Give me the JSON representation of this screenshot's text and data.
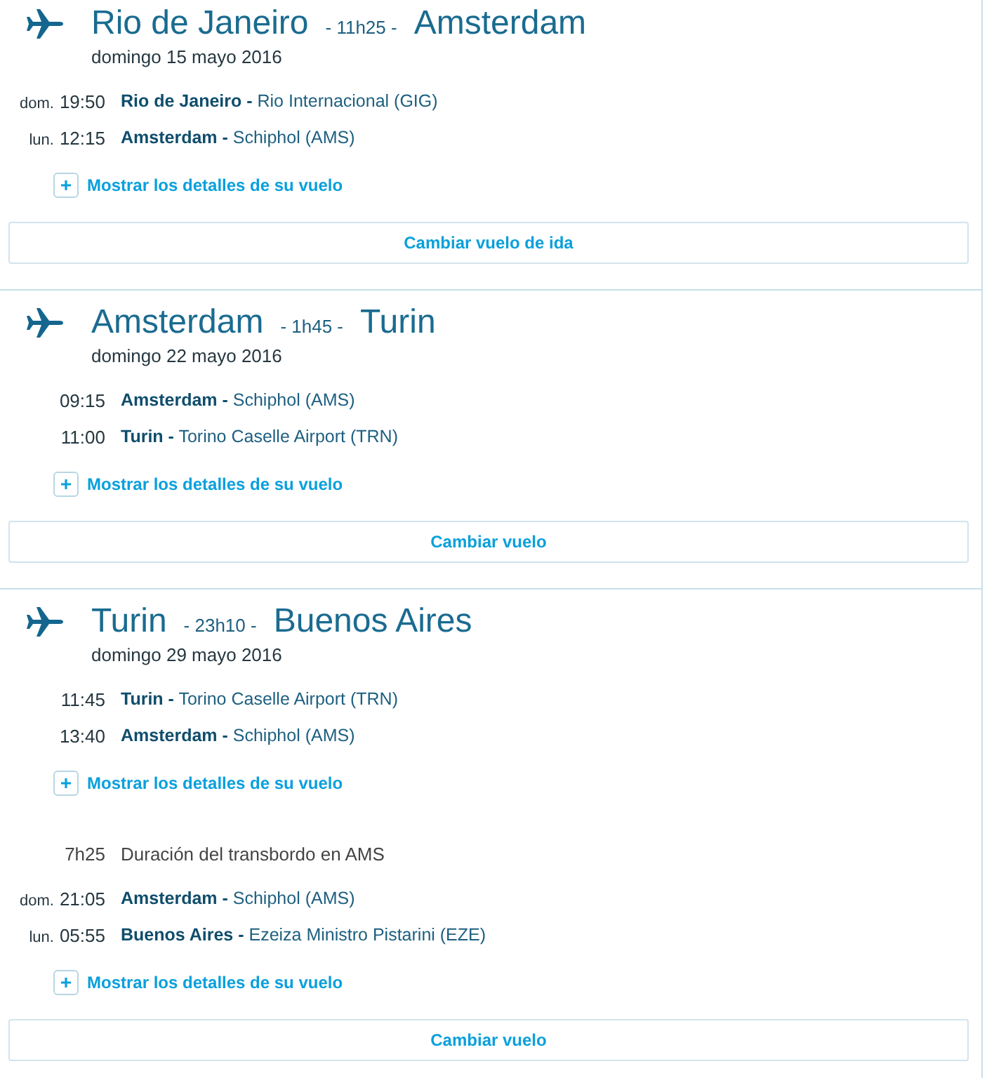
{
  "journeys": [
    {
      "origin": "Rio de Janeiro",
      "duration": "- 11h25 -",
      "destination": "Amsterdam",
      "date": "domingo 15 mayo 2016",
      "segments": [
        {
          "kind": "flight",
          "stops": [
            {
              "day": "dom.",
              "time": "19:50",
              "place": "**Rio de Janeiro -** Rio Internacional (GIG)"
            },
            {
              "day": "lun.",
              "time": "12:15",
              "place": "**Amsterdam -** Schiphol (AMS)"
            }
          ],
          "details_link": "Mostrar los detalles de su vuelo"
        }
      ],
      "change_button": "Cambiar vuelo de ida"
    },
    {
      "origin": "Amsterdam",
      "duration": "- 1h45 -",
      "destination": "Turin",
      "date": "domingo 22 mayo 2016",
      "segments": [
        {
          "kind": "flight",
          "stops": [
            {
              "time": "09:15",
              "place": "**Amsterdam -** Schiphol (AMS)"
            },
            {
              "time": "11:00",
              "place": "**Turin -** Torino Caselle Airport (TRN)"
            }
          ],
          "details_link": "Mostrar los detalles de su vuelo"
        }
      ],
      "change_button": "Cambiar vuelo"
    },
    {
      "origin": "Turin",
      "duration": "- 23h10 -",
      "destination": "Buenos Aires",
      "date": "domingo 29 mayo 2016",
      "segments": [
        {
          "kind": "flight",
          "stops": [
            {
              "time": "11:45",
              "place": "**Turin -** Torino Caselle Airport (TRN)"
            },
            {
              "time": "13:40",
              "place": "**Amsterdam -** Schiphol (AMS)"
            }
          ],
          "details_link": "Mostrar los detalles de su vuelo"
        },
        {
          "kind": "transfer",
          "duration": "7h25",
          "label": "Duración del transbordo en AMS"
        },
        {
          "kind": "flight",
          "stops": [
            {
              "day": "dom.",
              "time": "21:05",
              "place": "**Amsterdam -** Schiphol (AMS)"
            },
            {
              "day": "lun.",
              "time": "05:55",
              "place": "**Buenos Aires -** Ezeiza Ministro Pistarini (EZE)"
            }
          ],
          "details_link": "Mostrar los detalles de su vuelo"
        }
      ],
      "change_button": "Cambiar vuelo"
    }
  ]
}
